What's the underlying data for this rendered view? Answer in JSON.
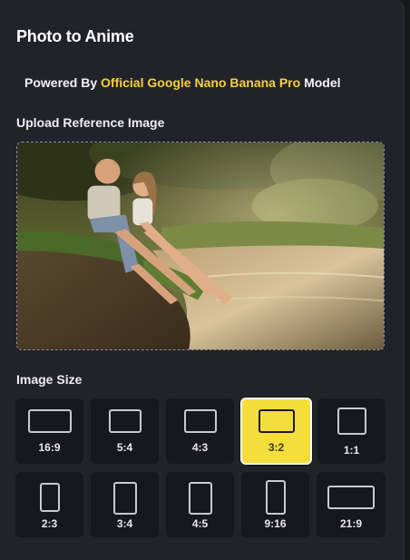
{
  "header": {
    "title": "Photo to Anime"
  },
  "powered": {
    "prefix": "Powered By",
    "model_name": "Official Google Nano Banana Pro",
    "suffix": "Model"
  },
  "upload": {
    "label": "Upload Reference Image",
    "image_description": "two children sitting on a riverbank"
  },
  "image_size": {
    "label": "Image Size",
    "selected": "3:2",
    "options": [
      "16:9",
      "5:4",
      "4:3",
      "3:2",
      "1:1",
      "2:3",
      "3:4",
      "4:5",
      "9:16",
      "21:9"
    ]
  },
  "colors": {
    "accent": "#f5dd3c",
    "link": "#f5d13a",
    "panel": "#22232a",
    "tile": "#17181d"
  }
}
